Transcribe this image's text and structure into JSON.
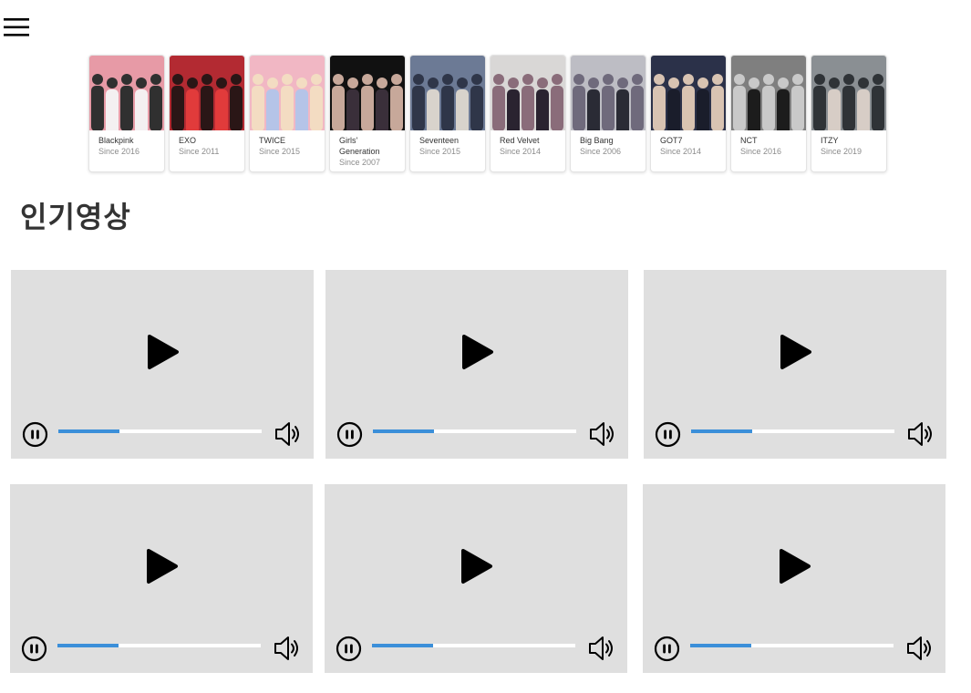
{
  "header": {
    "menu_icon": "hamburger-menu-icon"
  },
  "groups": [
    {
      "name": "Blackpink",
      "since": "Since 2016",
      "photo_colors": [
        "#e79aa6",
        "#f4f0f1",
        "#303030"
      ]
    },
    {
      "name": "EXO",
      "since": "Since 2011",
      "photo_colors": [
        "#b32a32",
        "#e13b3b",
        "#2a1616"
      ]
    },
    {
      "name": "TWICE",
      "since": "Since 2015",
      "photo_colors": [
        "#f1b7c4",
        "#b5c4e8",
        "#f3dcc2"
      ]
    },
    {
      "name": "Girls' Generation",
      "since": "Since 2007",
      "photo_colors": [
        "#111111",
        "#3a2f3a",
        "#c7a89a"
      ]
    },
    {
      "name": "Seventeen",
      "since": "Since 2015",
      "photo_colors": [
        "#6c7a95",
        "#d8d3cc",
        "#2f3649"
      ]
    },
    {
      "name": "Red Velvet",
      "since": "Since 2014",
      "photo_colors": [
        "#d9d7d6",
        "#2a2330",
        "#8a6c7a"
      ]
    },
    {
      "name": "Big Bang",
      "since": "Since 2006",
      "photo_colors": [
        "#bdbdc4",
        "#2a2b35",
        "#6f6a7c"
      ]
    },
    {
      "name": "GOT7",
      "since": "Since 2014",
      "photo_colors": [
        "#2b3149",
        "#1a1d2b",
        "#d8c3b2"
      ]
    },
    {
      "name": "NCT",
      "since": "Since 2016",
      "photo_colors": [
        "#7f7f7f",
        "#1c1c1c",
        "#c9c9c9"
      ]
    },
    {
      "name": "ITZY",
      "since": "Since 2019",
      "photo_colors": [
        "#8a8f93",
        "#d7cdc6",
        "#2f3337"
      ]
    }
  ],
  "popular": {
    "title": "인기영상",
    "videos": [
      {
        "progress": 0.3
      },
      {
        "progress": 0.3
      },
      {
        "progress": 0.3
      },
      {
        "progress": 0.3
      },
      {
        "progress": 0.3
      },
      {
        "progress": 0.3
      }
    ]
  },
  "colors": {
    "progress_fill": "#3b8fd9",
    "video_background": "#dfdfdf",
    "icon": "#000000"
  }
}
